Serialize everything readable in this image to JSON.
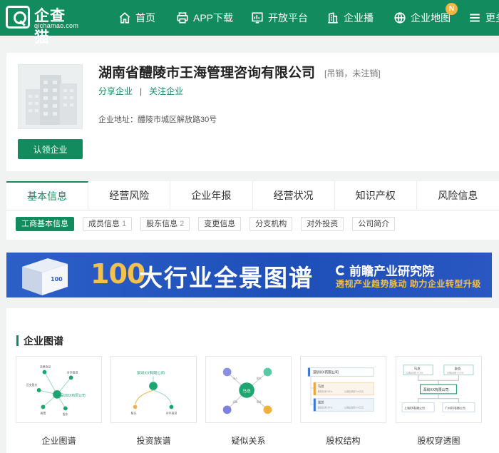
{
  "logo": {
    "name": "企查猫",
    "domain": "qichamao.com"
  },
  "nav": {
    "items": [
      {
        "label": "首页",
        "icon": "home-icon"
      },
      {
        "label": "APP下载",
        "icon": "printer-icon"
      },
      {
        "label": "开放平台",
        "icon": "chart-icon"
      },
      {
        "label": "企业播",
        "icon": "building-icon"
      },
      {
        "label": "企业地图",
        "icon": "globe-icon",
        "badge": "N"
      },
      {
        "label": "更多",
        "icon": "menu-icon"
      }
    ]
  },
  "company": {
    "name": "湖南省醴陵市王海管理咨询有限公司",
    "status": "[吊销，未注销]",
    "share_label": "分享企业",
    "separator": "|",
    "follow_label": "关注企业",
    "address_label": "企业地址：",
    "address": "醴陵市城区解放路30号",
    "claim_button": "认领企业"
  },
  "tabs": {
    "main": [
      {
        "label": "基本信息",
        "active": true
      },
      {
        "label": "经营风险"
      },
      {
        "label": "企业年报"
      },
      {
        "label": "经营状况"
      },
      {
        "label": "知识产权"
      },
      {
        "label": "风险信息"
      }
    ],
    "sub": [
      {
        "label": "工商基本信息",
        "count": "",
        "active": true
      },
      {
        "label": "成员信息",
        "count": "1"
      },
      {
        "label": "股东信息",
        "count": "2"
      },
      {
        "label": "变更信息",
        "count": ""
      },
      {
        "label": "分支机构",
        "count": ""
      },
      {
        "label": "对外投资",
        "count": ""
      },
      {
        "label": "公司简介",
        "count": ""
      }
    ]
  },
  "banner": {
    "number": "100",
    "title": "大行业全景图谱",
    "brand": "前瞻产业研究院",
    "slogan": "透视产业趋势脉动  助力企业转型升级",
    "book_label": "100",
    "colors": {
      "background": "#2d5fc9",
      "accent": "#f2c14e"
    }
  },
  "graphs": {
    "title": "企业图谱",
    "items": [
      {
        "label": "企业图谱",
        "thumb": {
          "center": "深圳XX有限公司",
          "nodes": [
            "法律诉讼",
            "对外投资",
            "历史股东",
            "高管",
            "股东"
          ]
        }
      },
      {
        "label": "投资族谱",
        "thumb": {
          "center": "深圳XX有限公司",
          "nodes": [
            "股东",
            "对外投资"
          ]
        }
      },
      {
        "label": "疑似关系",
        "thumb": {
          "center": "马总",
          "nodes": [
            "法人",
            "股东",
            "高管",
            "投资"
          ]
        }
      },
      {
        "label": "股权结构",
        "thumb": {
          "company": "深圳XX有限公司",
          "holders": [
            {
              "name": "马总",
              "detail": "股权比例 50%",
              "extra": "认缴出资额 XX万元"
            },
            {
              "name": "张总",
              "detail": "股权比例 45%",
              "extra": "认缴出资额 XX万元"
            }
          ]
        }
      },
      {
        "label": "股权穿透图",
        "thumb": {
          "top": [
            "马总",
            "张总"
          ],
          "top_detail": "认缴出资额 XX万元",
          "center": "深圳XX有限公司",
          "bottom": [
            "上海XX有限公司",
            "广州XX有限公司"
          ]
        }
      }
    ]
  },
  "colors": {
    "brand": "#128b5e",
    "badge": "#f5b53f"
  }
}
